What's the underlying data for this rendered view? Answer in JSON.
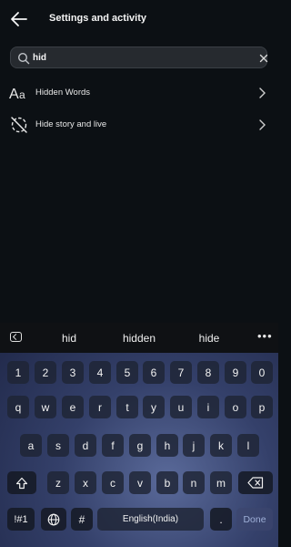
{
  "header": {
    "title": "Settings and activity"
  },
  "search": {
    "value": "hid",
    "placeholder": "Search"
  },
  "results": [
    {
      "label": "Hidden Words",
      "icon": "text-size-icon"
    },
    {
      "label": "Hide story and live",
      "icon": "hide-story-icon"
    }
  ],
  "keyboard": {
    "suggestions": [
      "hid",
      "hidden",
      "hide"
    ],
    "more_label": "•••",
    "row_numbers": [
      "1",
      "2",
      "3",
      "4",
      "5",
      "6",
      "7",
      "8",
      "9",
      "0"
    ],
    "row_top": [
      "q",
      "w",
      "e",
      "r",
      "t",
      "y",
      "u",
      "i",
      "o",
      "p"
    ],
    "row_middle": [
      "a",
      "s",
      "d",
      "f",
      "g",
      "h",
      "j",
      "k",
      "l"
    ],
    "row_bottom": [
      "z",
      "x",
      "c",
      "v",
      "b",
      "n",
      "m"
    ],
    "symbols_label": "!#1",
    "hash_label": "#",
    "space_label": "English(India)",
    "period_label": ".",
    "done_label": "Done"
  }
}
